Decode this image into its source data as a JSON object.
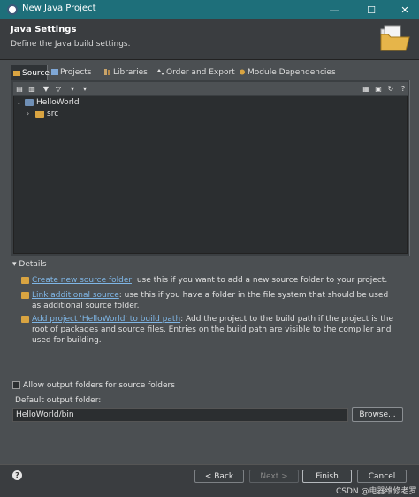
{
  "window": {
    "title": "New Java Project",
    "min": "—",
    "max": "☐",
    "close": "✕"
  },
  "header": {
    "title": "Java Settings",
    "description": "Define the Java build settings."
  },
  "tabs": [
    {
      "label": "Source",
      "active": true
    },
    {
      "label": "Projects",
      "active": false
    },
    {
      "label": "Libraries",
      "active": false
    },
    {
      "label": "Order and Export",
      "active": false
    },
    {
      "label": "Module Dependencies",
      "active": false
    }
  ],
  "toolbar": {
    "left_icons": [
      "add-folder-icon",
      "link-folder-icon",
      "filter-icon",
      "filter-clear-icon",
      "configure-icon",
      "menu-dropdown-icon"
    ],
    "right_icons": [
      "tree-icon",
      "folder-settings-icon",
      "refresh-icon",
      "help-icon"
    ]
  },
  "tree": {
    "project": {
      "label": "HelloWorld",
      "expanded": true
    },
    "children": [
      {
        "label": "src",
        "expanded": false
      }
    ]
  },
  "details": {
    "toggle_label": "Details",
    "items": [
      {
        "link": "Create new source folder",
        "text": ": use this if you want to add a new source folder to your project."
      },
      {
        "link": "Link additional source",
        "text": ": use this if you have a folder in the file system that should be used as additional source folder."
      },
      {
        "link": "Add project 'HelloWorld' to build path",
        "text": ": Add the project to the build path if the project is the root of packages and source files. Entries on the build path are visible to the compiler and used for building."
      }
    ]
  },
  "options": {
    "allow_output_folders_label": "Allow output folders for source folders",
    "allow_output_folders_checked": false,
    "default_output_folder_label": "Default output folder:",
    "default_output_folder_value": "HelloWorld/bin",
    "browse_label": "Browse..."
  },
  "footer": {
    "help": "?",
    "back_label": "< Back",
    "next_label": "Next >",
    "finish_label": "Finish",
    "cancel_label": "Cancel"
  },
  "watermark": "CSDN @电器维修老罗",
  "colors": {
    "title_bar": "#1e6f7a",
    "link": "#7fb6e6",
    "folder": "#d9a441"
  }
}
